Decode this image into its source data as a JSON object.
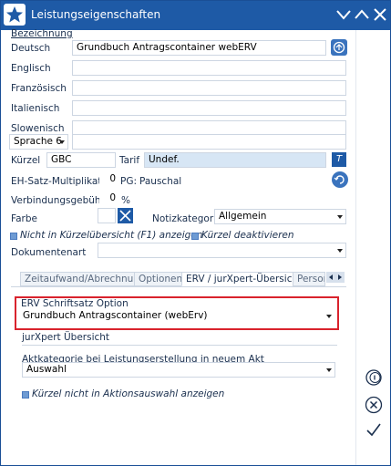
{
  "window": {
    "title": "Leistungseigenschaften"
  },
  "section_title": "Bezeichnung",
  "languages": [
    {
      "label": "Deutsch",
      "value": "Grundbuch Antragscontainer webERV"
    },
    {
      "label": "Englisch",
      "value": ""
    },
    {
      "label": "Französisch",
      "value": ""
    },
    {
      "label": "Italienisch",
      "value": ""
    },
    {
      "label": "Slowenisch",
      "value": ""
    }
  ],
  "language_select": {
    "value": "Sprache 6",
    "text": ""
  },
  "kurzel": {
    "label": "Kürzel",
    "value": "GBC"
  },
  "tarif": {
    "label": "Tarif",
    "value": "Undef.",
    "button": "T"
  },
  "eh": {
    "label": "EH-Satz-Multiplikator",
    "value": "0",
    "pg_label": "PG:",
    "pg_value": "Pauschal"
  },
  "gebuehr": {
    "label": "Verbindungsgebühr",
    "value": "0",
    "unit": "%"
  },
  "farbe": {
    "label": "Farbe"
  },
  "notizkategorie": {
    "label": "Notizkategorie",
    "value": "Allgemein"
  },
  "checks": {
    "nicht_in_uebersicht": {
      "label": "Nicht in Kürzelübersicht (F1) anzeigen",
      "checked": true
    },
    "kurzel_deaktivieren": {
      "label": "Kürzel deaktivieren",
      "checked": true
    }
  },
  "dokumentenart": {
    "label": "Dokumentenart",
    "value": ""
  },
  "tabs": [
    {
      "label": "Zeitaufwand/Abrechnung",
      "active": false
    },
    {
      "label": "Optionen",
      "active": false
    },
    {
      "label": "ERV / jurXpert-Übersicht",
      "active": true
    },
    {
      "label": "Person",
      "active": false
    }
  ],
  "erv": {
    "label": "ERV Schriftsatz Option",
    "value": "Grundbuch Antragscontainer (webErv)"
  },
  "jurxpert": {
    "label": "jurXpert Übersicht"
  },
  "aktkategorie": {
    "label": "Aktkategorie bei Leistungserstellung in neuem Akt",
    "value": "Auswahl"
  },
  "aktionsauswahl": {
    "label": "Kürzel nicht in Aktionsauswahl anzeigen",
    "checked": true
  },
  "colors": {
    "titlebar": "#1e5aa6",
    "highlight_border": "#d9232d",
    "field_blue": "#d7e6f5"
  }
}
